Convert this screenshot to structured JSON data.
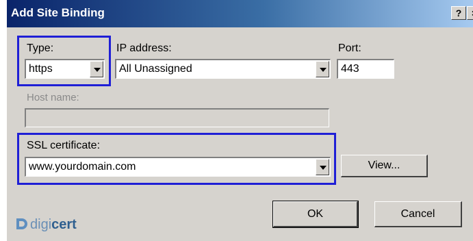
{
  "window": {
    "title": "Add Site Binding",
    "help_label": "?",
    "close_label": "×"
  },
  "fields": {
    "type": {
      "label": "Type:",
      "value": "https"
    },
    "ip": {
      "label": "IP address:",
      "value": "All Unassigned"
    },
    "port": {
      "label": "Port:",
      "value": "443"
    },
    "host": {
      "label": "Host name:",
      "value": ""
    },
    "ssl": {
      "label": "SSL certificate:",
      "value": "www.yourdomain.com"
    }
  },
  "buttons": {
    "view": "View...",
    "ok": "OK",
    "cancel": "Cancel"
  },
  "logo": {
    "prefix": "digi",
    "suffix": "cert"
  },
  "colors": {
    "highlight": "#1f1fd6",
    "titlebar_start": "#0a246a",
    "titlebar_end": "#a6caf0"
  }
}
